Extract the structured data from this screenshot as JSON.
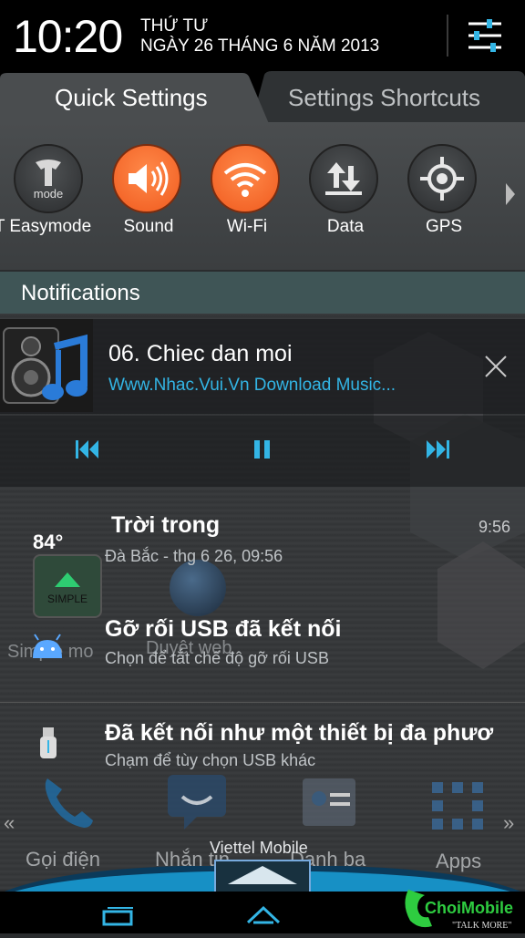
{
  "status": {
    "time": "10:20",
    "weekday": "THỨ TƯ",
    "date": "NGÀY 26 THÁNG 6 NĂM 2013"
  },
  "tabs": {
    "quick_settings": "Quick Settings",
    "settings_shortcuts": "Settings Shortcuts"
  },
  "quick_settings": [
    {
      "label": "T Easymode",
      "icon": "t-easymode-icon",
      "state": "off"
    },
    {
      "label": "Sound",
      "icon": "speaker-icon",
      "state": "on"
    },
    {
      "label": "Wi-Fi",
      "icon": "wifi-icon",
      "state": "on"
    },
    {
      "label": "Data",
      "icon": "data-arrows-icon",
      "state": "off"
    },
    {
      "label": "GPS",
      "icon": "gps-icon",
      "state": "off"
    }
  ],
  "easymode_icon_text": "mode",
  "notifications_header": "Notifications",
  "music": {
    "title": "06. Chiec dan moi",
    "subtitle": "Www.Nhac.Vui.Vn Download Music..."
  },
  "notifications": [
    {
      "title": "Trời trong",
      "subtitle": "Đà Bắc - thg 6 26, 09:56",
      "time": "9:56",
      "icon": "weather-icon"
    },
    {
      "title": "Gỡ rối USB đã kết nối",
      "subtitle": "Chọn để tắt chế độ gỡ rối USB",
      "icon": "android-debug-icon"
    },
    {
      "title": "Đã kết nối như một thiết bị đa phươ",
      "subtitle": "Chạm để tùy chọn USB khác",
      "icon": "usb-icon"
    }
  ],
  "background": {
    "temperature": "84°",
    "simple_widget": "SIMPLE",
    "shortcut_simple": "Simple mo",
    "shortcut_browser": "Duyệt web",
    "dock": [
      "Gọi điện",
      "Nhắn tin",
      "Danh bạ",
      "Apps"
    ],
    "carrier": "Viettel Mobile"
  },
  "watermark": {
    "brand": "ChoiMobile",
    "tagline": "\"TALK MORE\""
  },
  "colors": {
    "accent": "#33b5e5",
    "orange": "#f26522",
    "header": "#3f5556"
  }
}
